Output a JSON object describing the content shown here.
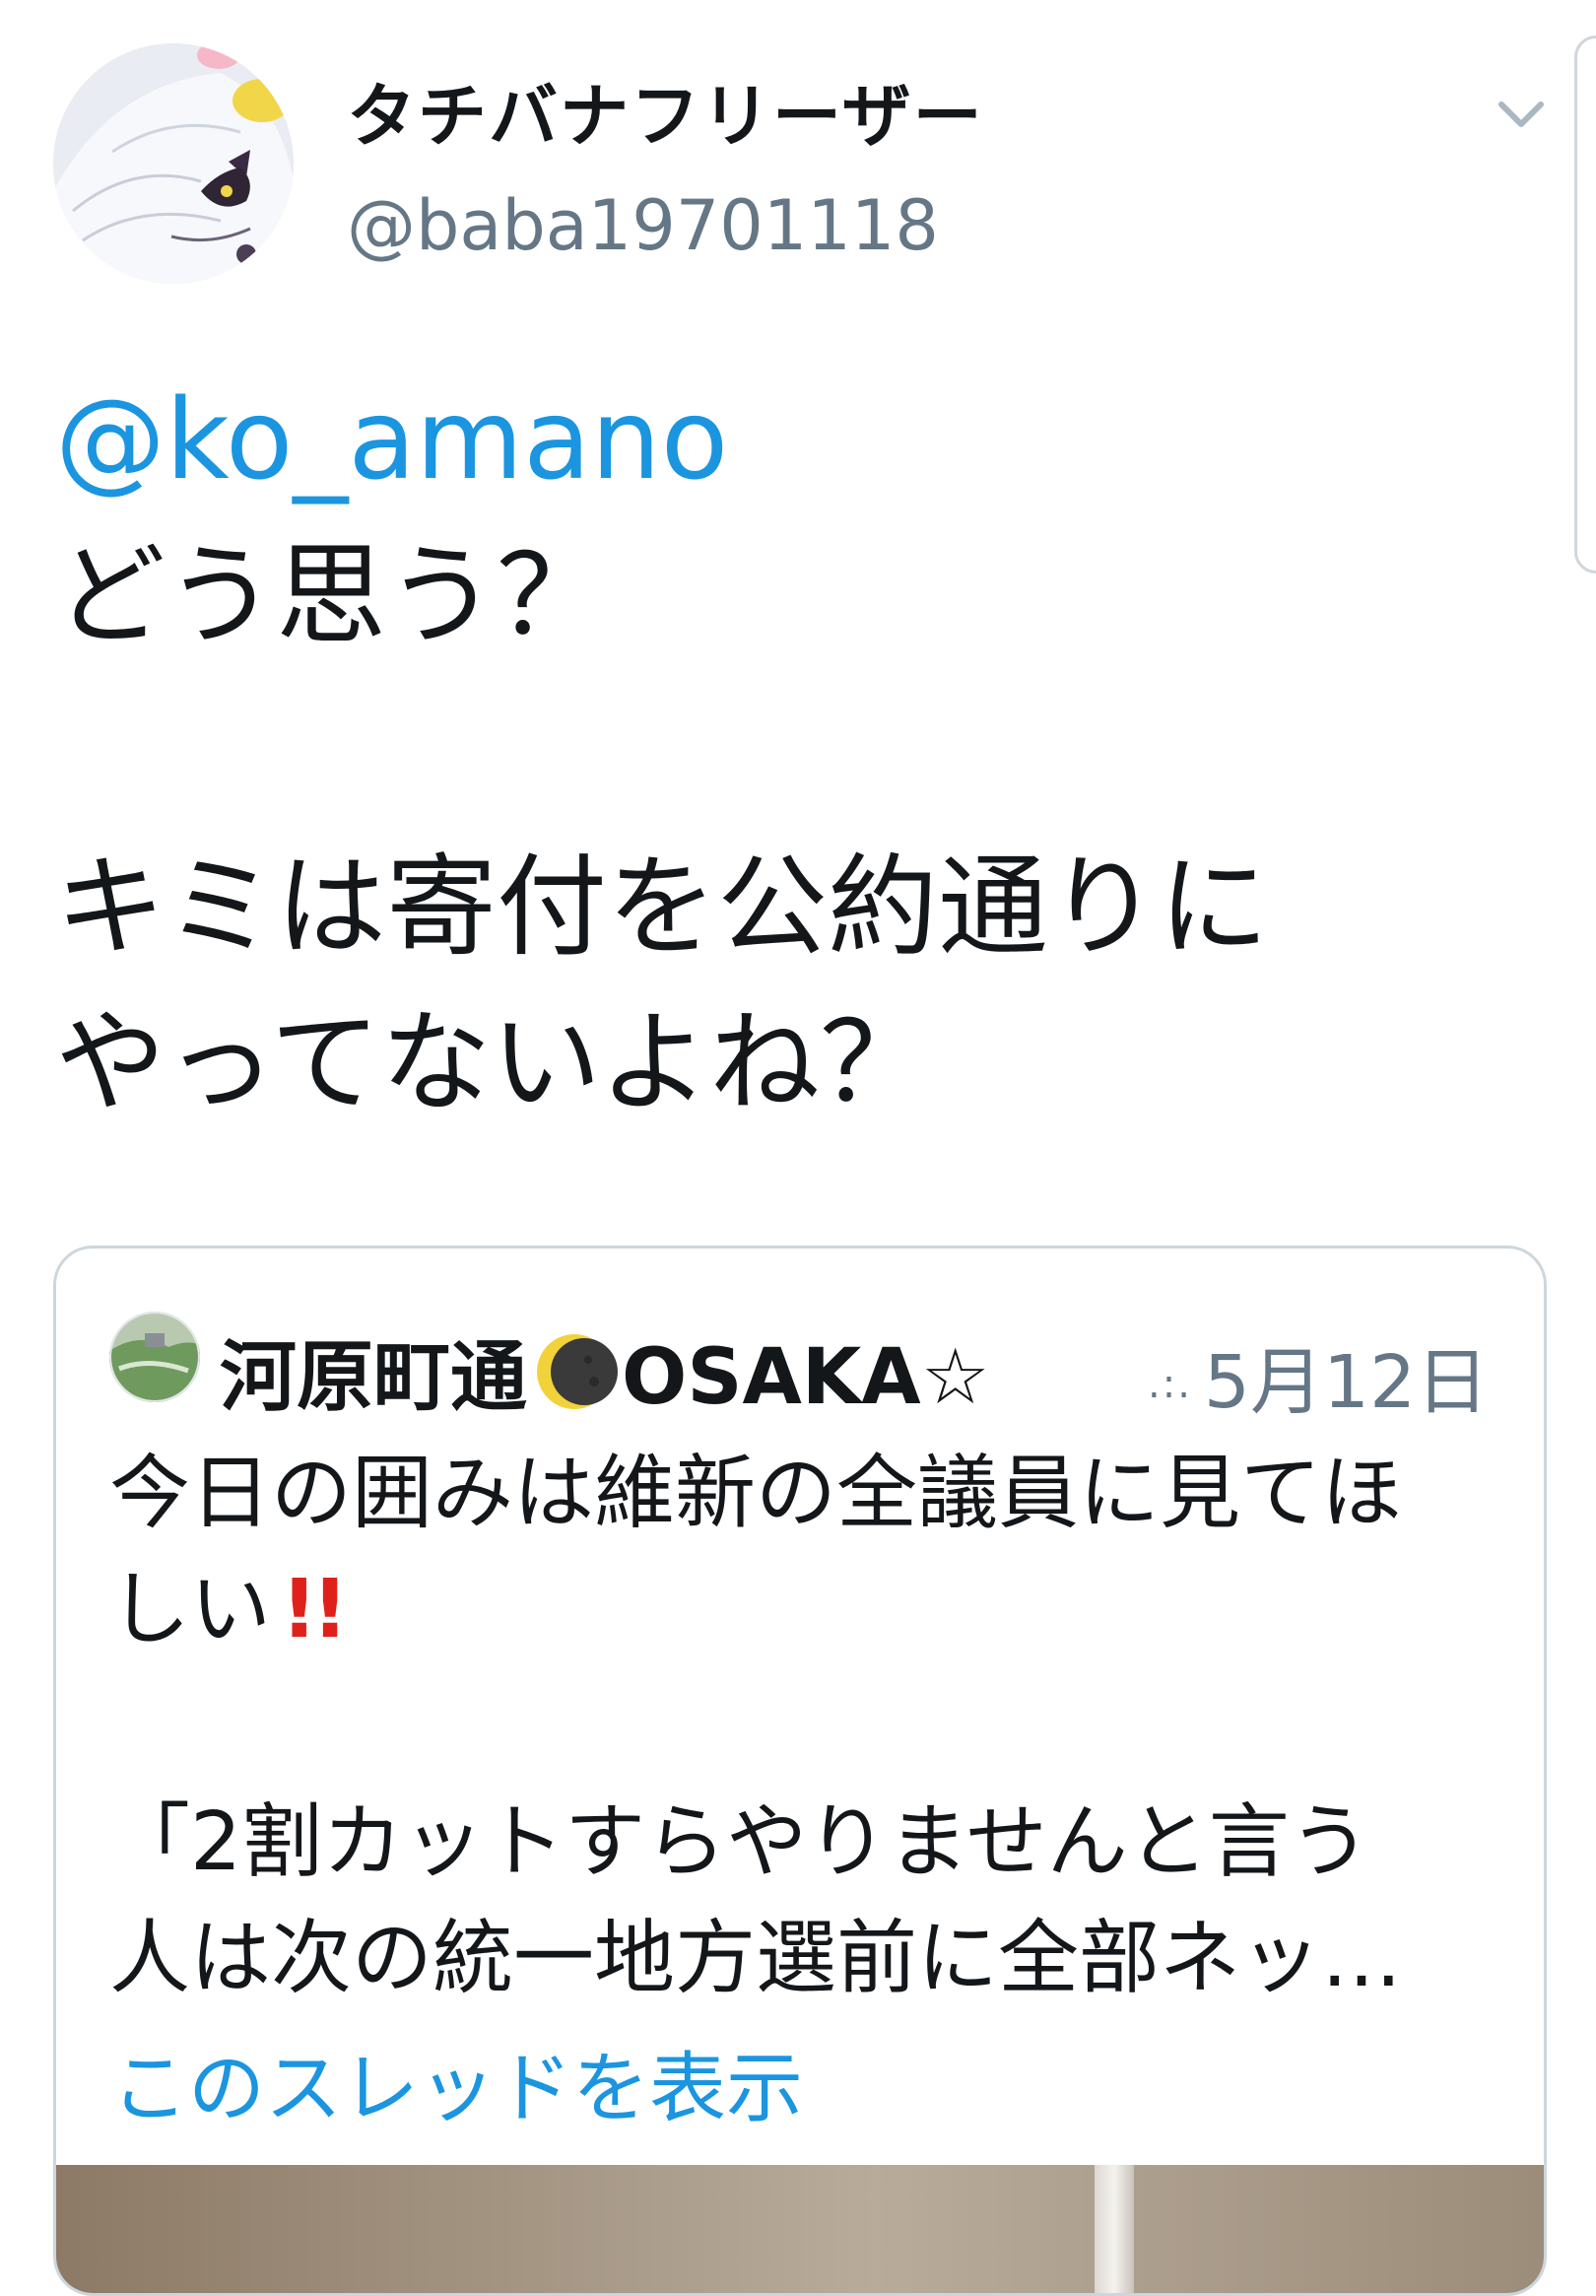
{
  "tweet": {
    "display_name": "タチバナフリーザー",
    "handle": "@baba19701118",
    "mention": "@ko_amano",
    "lines": [
      "どう思う？",
      "キミは寄付を公約通りに",
      "やってないよね？"
    ]
  },
  "quoted_tweet": {
    "name_part1": "河原町通",
    "name_part2": "OSAKA",
    "name_star": "☆",
    "date": "5月12日",
    "text_line1": "今日の囲みは維新の全議員に見てほ",
    "text_line2": "しい",
    "emphasis": "!!",
    "text_line3": "「2割カットすらやりませんと言う",
    "text_line4": "人は次の統一地方選前に全部ネッ…",
    "show_thread": "このスレッドを表示"
  },
  "icons": {
    "menu": "chevron-down-icon",
    "moon": "waning-crescent-moon-icon"
  },
  "colors": {
    "link": "#1b95e0",
    "secondary_text": "#657786",
    "emphasis": "#e0211b",
    "border": "#ccd6dd"
  }
}
